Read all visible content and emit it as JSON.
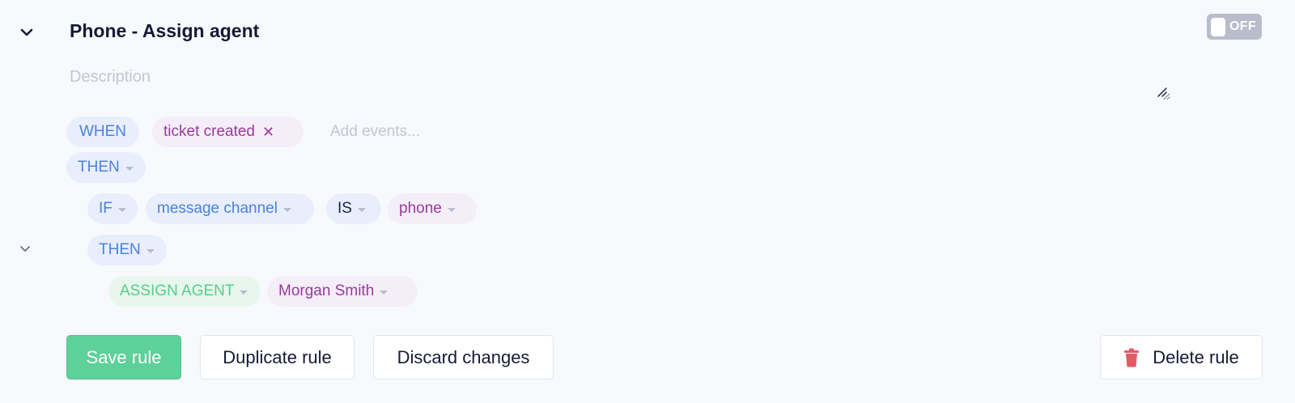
{
  "rule": {
    "title": "Phone - Assign agent",
    "toggle_label": "OFF",
    "description_placeholder": "Description"
  },
  "trigger": {
    "when_label": "WHEN",
    "events": [
      "ticket created"
    ],
    "add_events_placeholder": "Add events..."
  },
  "flow": {
    "then_label": "THEN",
    "condition": {
      "if_label": "IF",
      "field": "message channel",
      "operator": "IS",
      "value": "phone"
    },
    "inner_then_label": "THEN",
    "action": {
      "type": "ASSIGN AGENT",
      "value": "Morgan Smith"
    }
  },
  "buttons": {
    "save": "Save rule",
    "duplicate": "Duplicate rule",
    "discard": "Discard changes",
    "delete": "Delete rule"
  },
  "icons": {
    "collapse": "chevron-down-icon",
    "remove_event": "close-icon",
    "delete": "trash-icon",
    "resize": "resize-handle-icon"
  },
  "colors": {
    "blue": "#4b82dc",
    "purple": "#9a3a9e",
    "green": "#58cd88",
    "save_button": "#5ed09a",
    "delete_icon": "#e35a63",
    "toggle_off": "#b9bccb"
  }
}
